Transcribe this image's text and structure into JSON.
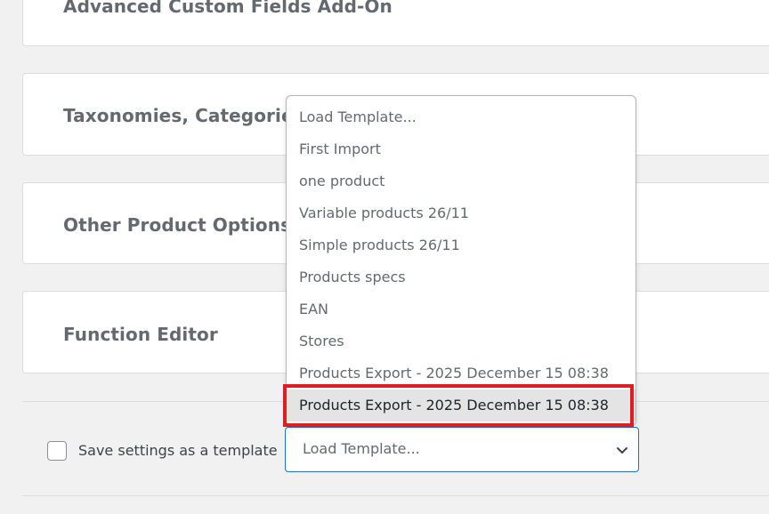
{
  "panels": {
    "acf": "Advanced Custom Fields Add-On",
    "taxonomies": "Taxonomies, Categories, Tags",
    "other_options": "Other Product Options",
    "function_editor": "Function Editor"
  },
  "template_row": {
    "checkbox_label": "Save settings as a template",
    "checkbox_checked": false,
    "select_value": "Load Template..."
  },
  "dropdown": {
    "options": [
      "Load Template...",
      "First Import",
      "one product",
      "Variable products 26/11",
      "Simple products 26/11",
      "Products specs",
      "EAN",
      "Stores",
      "Products Export - 2025 December 15 08:38",
      "Products Export - 2025 December 15 08:38"
    ],
    "highlighted_index": 9
  },
  "colors": {
    "highlight_border": "#e11d23",
    "focus_border": "#2271b1",
    "highlight_bg": "#e4e4e4"
  }
}
